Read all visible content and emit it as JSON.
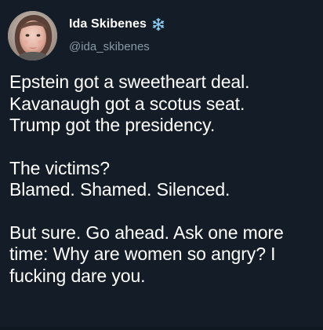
{
  "tweet": {
    "display_name": "Ida Skibenes",
    "badge_icon": "snowflake-icon",
    "handle": "@ida_skibenes",
    "avatar_icon": "profile-photo",
    "paragraphs": [
      "Epstein got a sweetheart deal.\nKavanaugh got a scotus seat.\nTrump got the presidency.",
      "The victims?\nBlamed. Shamed. Silenced.",
      "But sure. Go ahead. Ask one more\ntime: Why are women so angry? I\nfucking dare you."
    ]
  },
  "colors": {
    "background": "#141d27",
    "text_primary": "#ffffff",
    "text_secondary": "#8899a6",
    "badge_blue": "#8ecdf5"
  }
}
